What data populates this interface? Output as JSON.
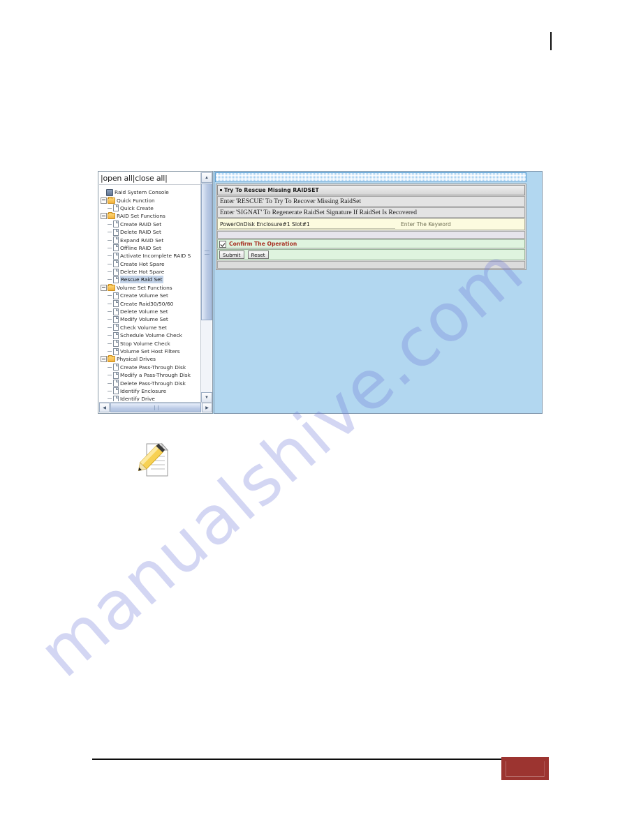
{
  "page": {
    "watermark_text": "manualshive.com",
    "top_mark": "|"
  },
  "sidebar": {
    "toolbar_label": "|open all|close all|",
    "scroll": {
      "up_arrow": "▲",
      "down_arrow": "▼",
      "left_arrow": "◀",
      "right_arrow": "▶"
    },
    "items": [
      {
        "label": "Raid System Console",
        "icon": "computer-icon",
        "level": 0,
        "kind": "root",
        "selected": false
      },
      {
        "label": "Quick Function",
        "icon": "folder-icon",
        "level": 0,
        "kind": "group",
        "selected": false
      },
      {
        "label": "Quick Create",
        "icon": "page-icon",
        "level": 1,
        "kind": "leaf",
        "selected": false
      },
      {
        "label": "RAID Set Functions",
        "icon": "folder-icon",
        "level": 0,
        "kind": "group",
        "selected": false
      },
      {
        "label": "Create RAID Set",
        "icon": "page-icon",
        "level": 1,
        "kind": "leaf",
        "selected": false
      },
      {
        "label": "Delete RAID Set",
        "icon": "page-icon",
        "level": 1,
        "kind": "leaf",
        "selected": false
      },
      {
        "label": "Expand RAID Set",
        "icon": "page-icon",
        "level": 1,
        "kind": "leaf",
        "selected": false
      },
      {
        "label": "Offline RAID Set",
        "icon": "page-icon",
        "level": 1,
        "kind": "leaf",
        "selected": false
      },
      {
        "label": "Activate Incomplete RAID S",
        "icon": "page-icon",
        "level": 1,
        "kind": "leaf",
        "selected": false
      },
      {
        "label": "Create Hot Spare",
        "icon": "page-icon",
        "level": 1,
        "kind": "leaf",
        "selected": false
      },
      {
        "label": "Delete Hot Spare",
        "icon": "page-icon",
        "level": 1,
        "kind": "leaf",
        "selected": false
      },
      {
        "label": "Rescue Raid Set",
        "icon": "page-icon",
        "level": 1,
        "kind": "leaf",
        "selected": true
      },
      {
        "label": "Volume Set Functions",
        "icon": "folder-icon",
        "level": 0,
        "kind": "group",
        "selected": false
      },
      {
        "label": "Create Volume Set",
        "icon": "page-icon",
        "level": 1,
        "kind": "leaf",
        "selected": false
      },
      {
        "label": "Create Raid30/50/60",
        "icon": "page-icon",
        "level": 1,
        "kind": "leaf",
        "selected": false
      },
      {
        "label": "Delete Volume Set",
        "icon": "page-icon",
        "level": 1,
        "kind": "leaf",
        "selected": false
      },
      {
        "label": "Modify Volume Set",
        "icon": "page-icon",
        "level": 1,
        "kind": "leaf",
        "selected": false
      },
      {
        "label": "Check Volume Set",
        "icon": "page-icon",
        "level": 1,
        "kind": "leaf",
        "selected": false
      },
      {
        "label": "Schedule Volume Check",
        "icon": "page-icon",
        "level": 1,
        "kind": "leaf",
        "selected": false
      },
      {
        "label": "Stop Volume Check",
        "icon": "page-icon",
        "level": 1,
        "kind": "leaf",
        "selected": false
      },
      {
        "label": "Volume Set Host Filters",
        "icon": "page-icon",
        "level": 1,
        "kind": "leaf",
        "selected": false
      },
      {
        "label": "Physical Drives",
        "icon": "folder-icon",
        "level": 0,
        "kind": "group",
        "selected": false
      },
      {
        "label": "Create Pass-Through Disk",
        "icon": "page-icon",
        "level": 1,
        "kind": "leaf",
        "selected": false
      },
      {
        "label": "Modify a Pass-Through Disk",
        "icon": "page-icon",
        "level": 1,
        "kind": "leaf",
        "selected": false
      },
      {
        "label": "Delete Pass-Through Disk",
        "icon": "page-icon",
        "level": 1,
        "kind": "leaf",
        "selected": false
      },
      {
        "label": "Identify Enclosure",
        "icon": "page-icon",
        "level": 1,
        "kind": "leaf",
        "selected": false
      },
      {
        "label": "Identify Drive",
        "icon": "page-icon",
        "level": 1,
        "kind": "leaf",
        "selected": false
      }
    ]
  },
  "form": {
    "title": "Try To Rescue Missing RAIDSET",
    "note1": "Enter 'RESCUE' To Try To Recover Missing RaidSet",
    "note2": "Enter 'SIGNAT' To Regenerate RaidSet Signature If RaidSet Is Recovered",
    "keyword_value": "PowerOnDisk Enclosure#1 Slot#1",
    "keyword_placeholder": "Enter The Keyword",
    "keyword_hint": "Enter The Keyword",
    "confirm_label": "Confirm The Operation",
    "confirm_checked": true,
    "submit_label": "Submit",
    "reset_label": "Reset"
  },
  "colors": {
    "panel_blue": "#b2d7f0",
    "confirm_red": "#a83224",
    "confirm_row_green": "#dff4df",
    "keyword_row_yellow": "#fcfbdf",
    "footer_box_red": "#9c3430",
    "selection_blue": "#c3d3e8"
  }
}
